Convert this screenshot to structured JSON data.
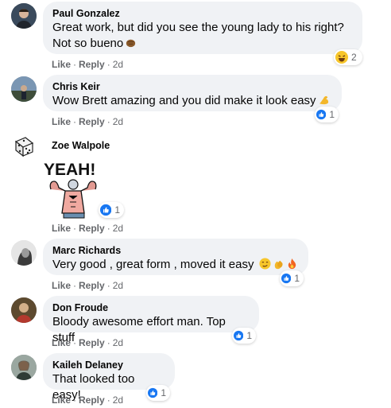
{
  "actions": {
    "like": "Like",
    "reply": "Reply"
  },
  "comments": [
    {
      "author": "Paul Gonzalez",
      "text": "Great work, but did you see the young lady to his right?\nNot so bueno",
      "emoji": "fist-bump-icon",
      "reaction": "haha-icon",
      "reaction_count": "2",
      "time": "2d"
    },
    {
      "author": "Chris Keir",
      "text": "Wow Brett amazing and you did make it look easy",
      "emoji": "flexed-biceps-icon",
      "reaction": "like-icon",
      "reaction_count": "1",
      "time": "2d"
    },
    {
      "author": "Zoe Walpole",
      "sticker_text": "YEAH!",
      "reaction": "like-icon",
      "reaction_count": "1",
      "time": "2d"
    },
    {
      "author": "Marc Richards",
      "text": "Very good , great form , moved it easy",
      "emoji": "smirk-clap-fire-icons",
      "reaction": "like-icon",
      "reaction_count": "1",
      "time": "2d"
    },
    {
      "author": "Don Froude",
      "text": "Bloody awesome effort man. Top stuff",
      "reaction": "like-icon",
      "reaction_count": "1",
      "time": "2d"
    },
    {
      "author": "Kaileh Delaney",
      "text": "That looked too easy!",
      "reaction": "like-icon",
      "reaction_count": "1",
      "time": "2d"
    }
  ],
  "colors": {
    "bubble": "#f0f2f5",
    "like_blue": "#1877f2",
    "meta_gray": "#65676b"
  }
}
